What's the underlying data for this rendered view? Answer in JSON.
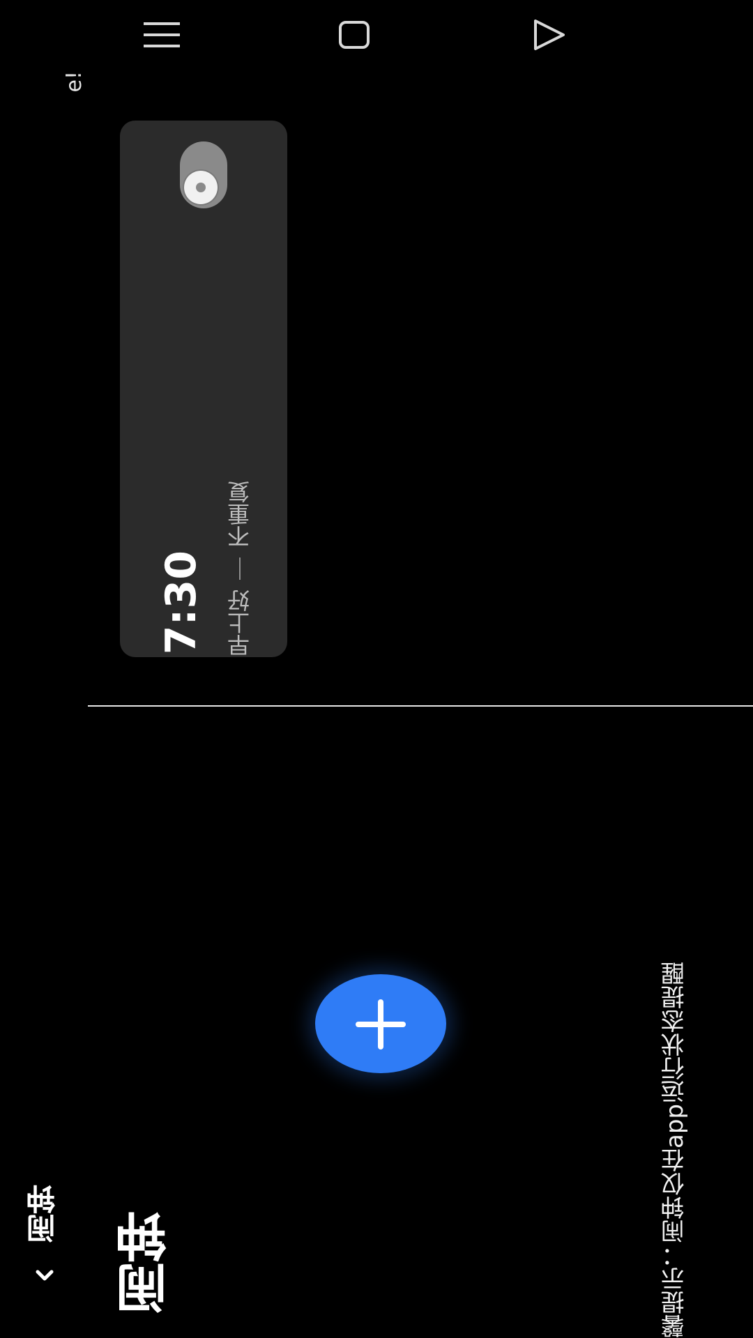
{
  "header": {
    "back_label": "‹",
    "nav_title": "闹钟",
    "page_title": "闹钟",
    "cut_text": "e!"
  },
  "alarm": {
    "time": "7:30",
    "label": "早上好",
    "separator": "|",
    "repeat": "不重复",
    "enabled": false
  },
  "actions": {
    "add_alarm_icon": "plus-icon"
  },
  "tip": {
    "text": "温馨提示：闹钟仅在app运行状态提醒"
  },
  "system_nav": {
    "recents_icon": "recents-icon",
    "home_icon": "home-icon",
    "back_icon": "back-triangle-icon"
  },
  "colors": {
    "background": "#000000",
    "card": "#2b2b2b",
    "accent": "#2f7cf6"
  }
}
